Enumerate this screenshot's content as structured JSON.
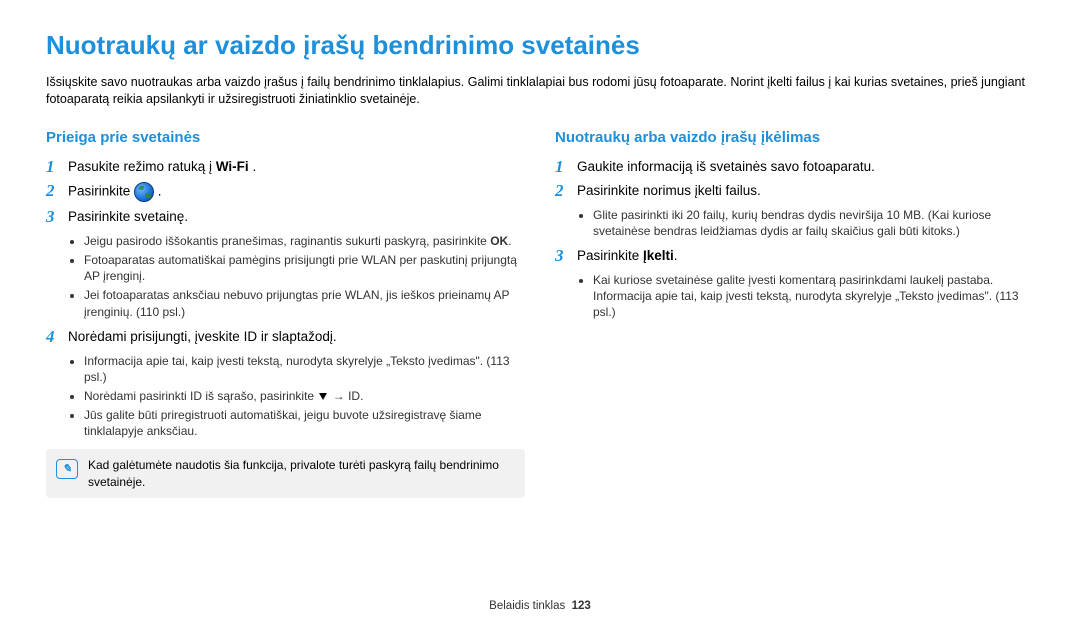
{
  "title": "Nuotraukų ar vaizdo įrašų bendrinimo svetainės",
  "intro": "Išsiųskite savo nuotraukas arba vaizdo įrašus į failų bendrinimo tinklalapius. Galimi tinklalapiai bus rodomi jūsų fotoaparate. Norint įkelti failus į kai kurias svetaines, prieš jungiant fotoaparatą reikia apsilankyti ir užsiregistruoti žiniatinklio svetainėje.",
  "left": {
    "heading": "Prieiga prie svetainės",
    "steps": {
      "s1": "Pasukite režimo ratuką į ",
      "s1_wifi": "Wi-Fi",
      "s1_end": " .",
      "s2a": "Pasirinkite ",
      "s2b": " .",
      "s3": "Pasirinkite svetainę.",
      "s3_sub1a": "Jeigu pasirodo iššokantis pranešimas, raginantis sukurti paskyrą, pasirinkite ",
      "s3_sub1_ok": "OK",
      "s3_sub1b": ".",
      "s3_sub2": "Fotoaparatas automatiškai pamėgins prisijungti prie WLAN per paskutinį prijungtą AP įrenginį.",
      "s3_sub3": "Jei fotoaparatas anksčiau nebuvo prijungtas prie WLAN, jis ieškos prieinamų AP įrenginių. (110 psl.)",
      "s4": "Norėdami prisijungti, įveskite ID ir slaptažodį.",
      "s4_sub1": "Informacija apie tai, kaip įvesti tekstą, nurodyta skyrelyje „Teksto įvedimas\". (113 psl.)",
      "s4_sub2a": "Norėdami pasirinkti ID iš sąrašo, pasirinkite ",
      "s4_sub2b": " → ID.",
      "s4_sub3": "Jūs galite būti priregistruoti automatiškai, jeigu buvote užsiregistravę šiame tinklalapyje anksčiau."
    },
    "note": "Kad galėtumėte naudotis šia funkcija, privalote turėti paskyrą failų bendrinimo svetainėje."
  },
  "right": {
    "heading": "Nuotraukų arba vaizdo įrašų įkėlimas",
    "steps": {
      "s1": "Gaukite informaciją iš svetainės savo fotoaparatu.",
      "s2": "Pasirinkite norimus įkelti failus.",
      "s2_sub1": "Glite pasirinkti iki 20 failų, kurių bendras dydis neviršija 10 MB. (Kai kuriose svetainėse bendras leidžiamas dydis ar failų skaičius gali būti kitoks.)",
      "s3a": "Pasirinkite ",
      "s3_bold": "Įkelti",
      "s3b": ".",
      "s3_sub1": "Kai kuriose svetainėse galite įvesti komentarą pasirinkdami laukelį pastaba. Informacija apie tai, kaip įvesti tekstą, nurodyta skyrelyje „Teksto įvedimas\". (113 psl.)"
    }
  },
  "footer": {
    "section": "Belaidis tinklas",
    "page": "123"
  }
}
